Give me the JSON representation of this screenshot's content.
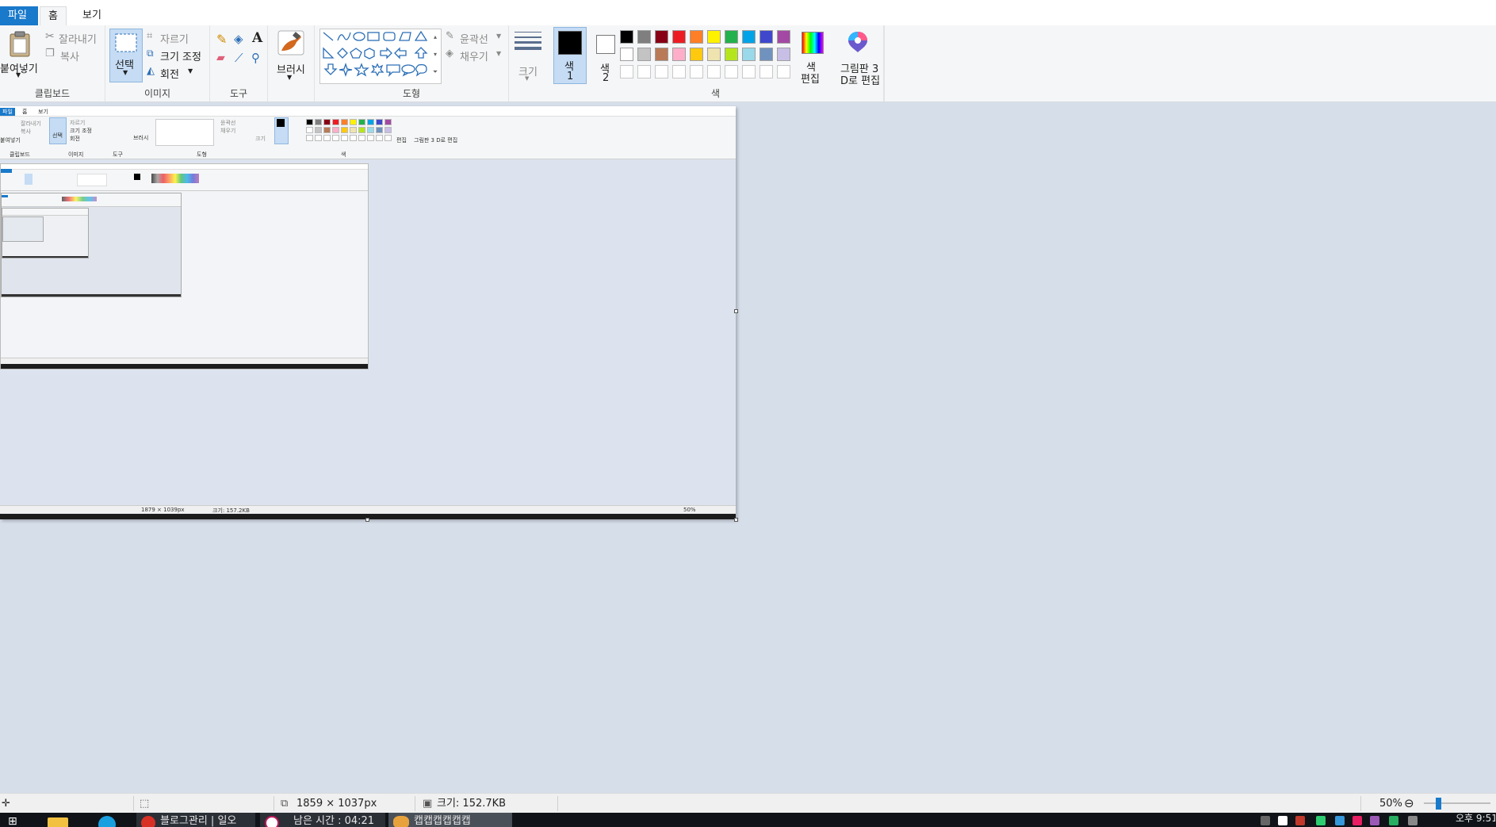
{
  "menu": {
    "file_tab": "파일",
    "home_tab": "홈",
    "view_tab": "보기"
  },
  "clipboard": {
    "paste": "붙여넣기",
    "cut": "잘라내기",
    "copy": "복사",
    "group": "클립보드"
  },
  "image": {
    "select": "선택",
    "crop": "자르기",
    "resize": "크기 조정",
    "rotate": "회전",
    "group": "이미지"
  },
  "tools": {
    "group": "도구",
    "text_glyph": "A"
  },
  "brushes": {
    "label": "브러시"
  },
  "shapes": {
    "outline": "윤곽선",
    "fill": "채우기",
    "group": "도형"
  },
  "size": {
    "label": "크기"
  },
  "colors": {
    "color1_a": "색",
    "color1_b": "1",
    "color2_a": "색",
    "color2_b": "2",
    "edit_a": "색",
    "edit_b": "편집",
    "paint3d_a": "그림판 3",
    "paint3d_b": "D로 편집",
    "group": "색",
    "color1_value": "#000000",
    "color2_value": "#ffffff",
    "palette_row1": [
      "#000000",
      "#7f7f7f",
      "#880015",
      "#ed1c24",
      "#ff7f27",
      "#fff200",
      "#22b14c",
      "#00a2e8",
      "#3f48cc",
      "#a349a4"
    ],
    "palette_row2": [
      "#ffffff",
      "#c3c3c3",
      "#b97a57",
      "#ffaec9",
      "#ffc90e",
      "#efe4b0",
      "#b5e61d",
      "#99d9ea",
      "#7092be",
      "#c8bfe7"
    ]
  },
  "status": {
    "dimensions": "1859 × 1037px",
    "filesize": "크기: 152.7KB",
    "zoom": "50%"
  },
  "nested": {
    "dimensions": "1879 × 1039px",
    "filesize": "크기: 157.2KB",
    "zoom": "50%",
    "file_tab": "파일",
    "home_tab": "홈",
    "view_tab": "보기",
    "clipboard": "클립보드",
    "image": "이미지",
    "tools": "도구",
    "shapes": "도형",
    "color": "색",
    "edit": "편집",
    "paint3d": "그림판 3 D로 편집",
    "cut": "잘라내기",
    "copy": "복사",
    "crop": "자르기",
    "resize": "크기 조정",
    "rotate": "회전",
    "brush": "브러시",
    "outline": "윤곽선",
    "fill": "채우기",
    "size": "크기",
    "select": "선택",
    "paste": "붙여넣기"
  },
  "taskbar": {
    "item1": "블로그관리 | 일오",
    "item2": "남은 시간 : 04:21",
    "item3": "캡캡캡캡캡캡",
    "clock": "오후 9:51"
  },
  "icons": [
    "paste-icon",
    "scissors-icon",
    "copy-icon",
    "select-icon",
    "crop-icon",
    "resize-icon",
    "rotate-icon",
    "pencil-icon",
    "fill-bucket-icon",
    "text-icon",
    "eraser-icon",
    "color-picker-icon",
    "magnifier-icon",
    "brush-icon",
    "size-lines-icon",
    "rainbow-icon",
    "paint3d-icon",
    "zoom-out-icon",
    "windows-icon",
    "folder-icon",
    "browser-icon"
  ]
}
